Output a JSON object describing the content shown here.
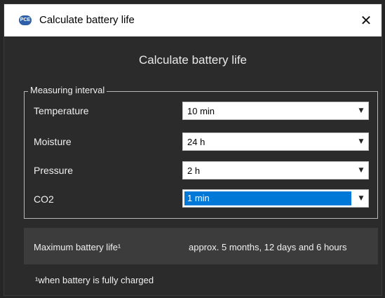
{
  "window": {
    "title": "Calculate battery life",
    "app_icon_text": "PCE",
    "close_glyph": "✕"
  },
  "heading": "Calculate battery life",
  "measuring_interval": {
    "legend": "Measuring interval",
    "rows": [
      {
        "label": "Temperature",
        "value": "10 min"
      },
      {
        "label": "Moisture",
        "value": "24 h"
      },
      {
        "label": "Pressure",
        "value": "2 h"
      },
      {
        "label": "CO2",
        "value": "1 min"
      }
    ],
    "dropdown_arrow": "▼"
  },
  "result": {
    "label": "Maximum battery life¹",
    "value": "approx. 5 months, 12 days and 6 hours"
  },
  "footnote": "¹when battery is fully charged",
  "colors": {
    "accent": "#0078d7",
    "background": "#2b2b2b",
    "result_panel": "#3c3c3c"
  }
}
